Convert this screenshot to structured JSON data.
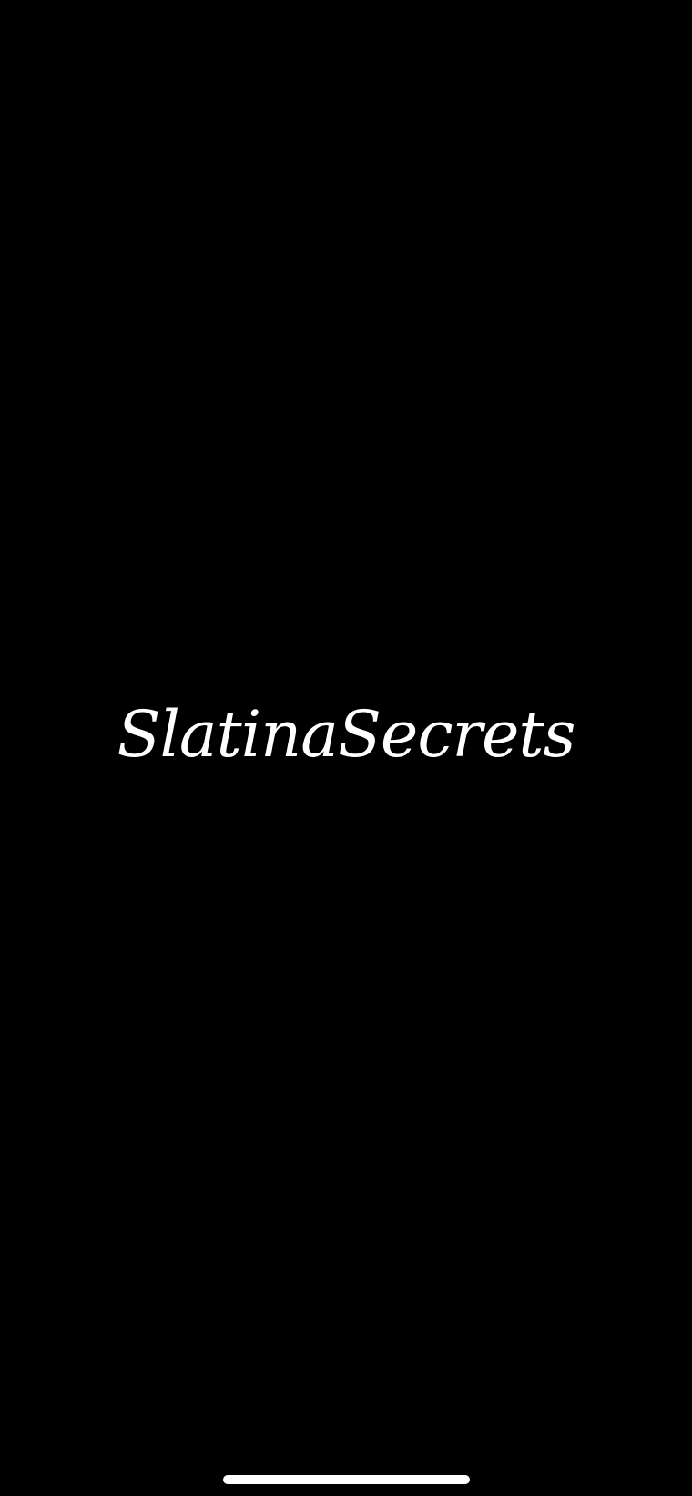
{
  "app": {
    "brand_name": "SlatinaSecrets"
  },
  "colors": {
    "background": "#000000",
    "logo_text": "#ffffff",
    "home_indicator": "#ffffff"
  }
}
